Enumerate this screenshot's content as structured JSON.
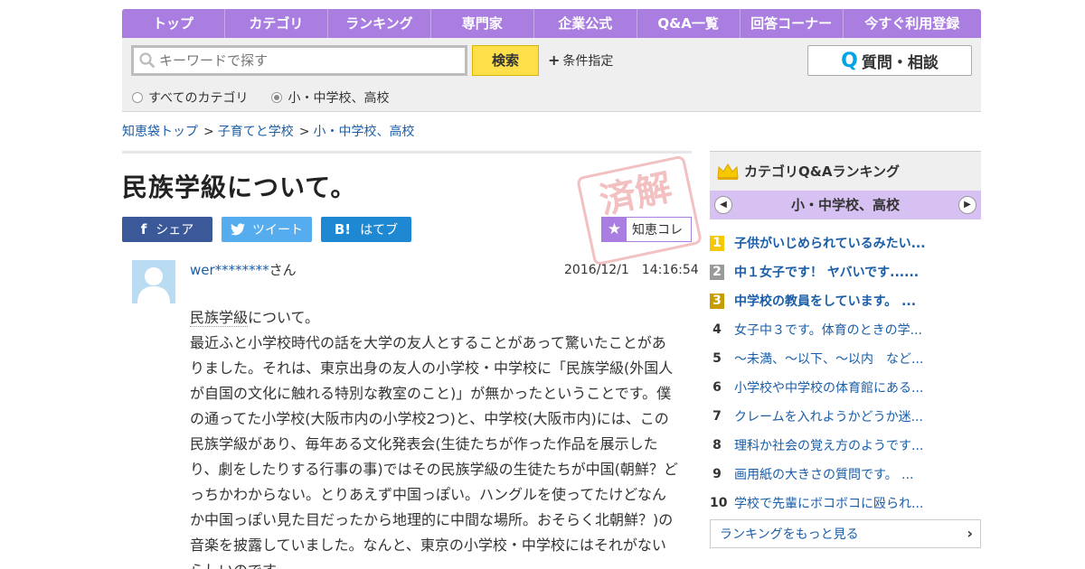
{
  "nav": [
    {
      "label": "トップ"
    },
    {
      "label": "カテゴリ"
    },
    {
      "label": "ランキング"
    },
    {
      "label": "専門家"
    },
    {
      "label": "企業公式"
    },
    {
      "label": "Q&A一覧"
    },
    {
      "label": "回答コーナー"
    },
    {
      "label": "今すぐ利用登録"
    }
  ],
  "search": {
    "placeholder": "キーワードで探す",
    "button": "検索",
    "conditions": "条件指定",
    "ask_button": "質問・相談",
    "radio_all": "すべてのカテゴリ",
    "radio_current": "小・中学校、高校"
  },
  "breadcrumb": {
    "top": "知恵袋トップ",
    "sep": ">",
    "cat1": "子育てと学校",
    "cat2": "小・中学校、高校"
  },
  "question": {
    "title": "民族学級について。",
    "stamp": "済解",
    "share": {
      "fb": "シェア",
      "tw": "ツイート",
      "hb": "はてブ",
      "fb_icon": "f",
      "hb_icon": "B!"
    },
    "chie": "知恵コレ",
    "author_name": "wer********",
    "author_suffix": "さん",
    "datetime": "2016/12/1　14:16:54",
    "body_keyword": "民族学級",
    "body_first_rest": "について。",
    "body_rest": "最近ふと小学校時代の話を大学の友人とすることがあって驚いたことがありました。それは、東京出身の友人の小学校・中学校に「民族学級(外国人が自国の文化に触れる特別な教室のこと)」が無かったということです。僕の通ってた小学校(大阪市内の小学校2つ)と、中学校(大阪市内)には、この民族学級があり、毎年ある文化発表会(生徒たちが作った作品を展示したり、劇をしたりする行事の事)ではその民族学級の生徒たちが中国(朝鮮？どっちかわからない。とりあえず中国っぽい。ハングルを使ってたけどなんか中国っぽい見た目だったから地理的に中間な場所。おそらく北朝鮮？)の音楽を披露していました。なんと、東京の小学校・中学校にはそれがないらしいのです。"
  },
  "ranking": {
    "title": "カテゴリQ&Aランキング",
    "category": "小・中学校、高校",
    "prev": "◀",
    "next": "▶",
    "items": [
      {
        "rank": "1",
        "text": "子供がいじめられているみたい..."
      },
      {
        "rank": "2",
        "text": "中１女子です！ ヤバいです......"
      },
      {
        "rank": "3",
        "text": "中学校の教員をしています。 ..."
      },
      {
        "rank": "4",
        "text": "女子中３です。体育のときの学..."
      },
      {
        "rank": "5",
        "text": "～未満、～以下、～以内　など..."
      },
      {
        "rank": "6",
        "text": "小学校や中学校の体育館にある..."
      },
      {
        "rank": "7",
        "text": "クレームを入れようかどうか迷..."
      },
      {
        "rank": "8",
        "text": "理科か社会の覚え方のようです..."
      },
      {
        "rank": "9",
        "text": "画用紙の大きさの質問です。 ..."
      },
      {
        "rank": "10",
        "text": "学校で先輩にボコボコに殴られ..."
      }
    ],
    "more": "ランキングをもっと見る"
  },
  "colors": {
    "nav": "#a97ee0",
    "link": "#1a5ea8",
    "search_button": "#ffe04a"
  }
}
